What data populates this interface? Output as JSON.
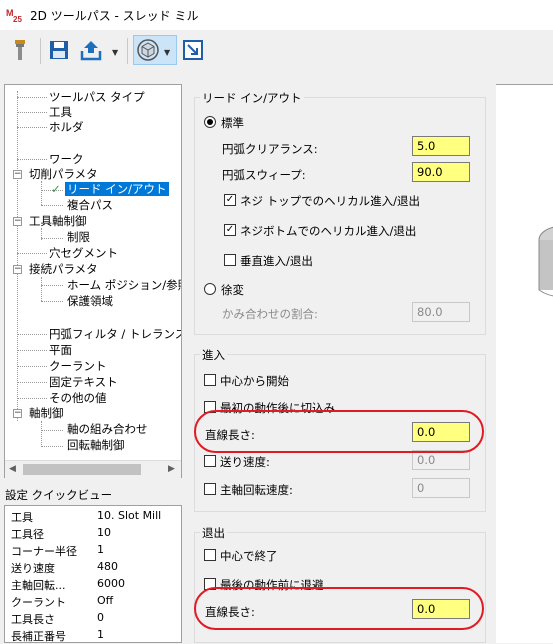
{
  "window": {
    "title": "2D ツールパス - スレッド ミル"
  },
  "toolbar": {
    "icons": [
      "tool-icon",
      "save-icon",
      "upload-icon",
      "view-cube-icon",
      "window-resize-icon"
    ]
  },
  "tree": {
    "items": [
      {
        "label": "ツールパス タイプ"
      },
      {
        "label": "工具"
      },
      {
        "label": "ホルダ"
      },
      {
        "label": "ワーク"
      },
      {
        "label": "切削パラメタ"
      },
      {
        "label": "リード イン/アウト",
        "selected": true
      },
      {
        "label": "複合パス"
      },
      {
        "label": "工具軸制御"
      },
      {
        "label": "制限"
      },
      {
        "label": "穴セグメント"
      },
      {
        "label": "接続パラメタ"
      },
      {
        "label": "ホーム ポジション/参照点"
      },
      {
        "label": "保護領域"
      },
      {
        "label": "円弧フィルタ / トレランス"
      },
      {
        "label": "平面"
      },
      {
        "label": "クーラント"
      },
      {
        "label": "固定テキスト"
      },
      {
        "label": "その他の値"
      },
      {
        "label": "軸制御"
      },
      {
        "label": "軸の組み合わせ"
      },
      {
        "label": "回転軸制御"
      }
    ]
  },
  "quickview": {
    "title": "設定 クイックビュー",
    "rows": [
      {
        "key": "工具",
        "value": "10. Slot Mill"
      },
      {
        "key": "工具径",
        "value": "10"
      },
      {
        "key": "コーナー半径",
        "value": "1"
      },
      {
        "key": "送り速度",
        "value": "480"
      },
      {
        "key": "主軸回転...",
        "value": "6000"
      },
      {
        "key": "クーラント",
        "value": "Off"
      },
      {
        "key": "工具長さ",
        "value": "0"
      },
      {
        "key": "長補正番号",
        "value": "1"
      }
    ]
  },
  "leadinout": {
    "group_title": "リード イン/アウト",
    "standard_label": "標準",
    "arc_clearance_label": "円弧クリアランス:",
    "arc_clearance_value": "5.0",
    "arc_sweep_label": "円弧スウィープ:",
    "arc_sweep_value": "90.0",
    "helical_top_label": "ネジ トップでのヘリカル進入/退出",
    "helical_bottom_label": "ネジボトムでのヘリカル進入/退出",
    "vertical_label": "垂直進入/退出",
    "gradual_label": "徐変",
    "overlap_label": "かみ合わせの割合:",
    "overlap_value": "80.0"
  },
  "entry": {
    "group_title": "進入",
    "start_center_label": "中心から開始",
    "plunge_first_label": "最初の動作後に切込み",
    "line_length_label": "直線長さ:",
    "line_length_value": "0.0",
    "feed_label": "送り速度:",
    "feed_value": "0.0",
    "spindle_label": "主軸回転速度:",
    "spindle_value": "0"
  },
  "exit": {
    "group_title": "退出",
    "end_center_label": "中心で終了",
    "retract_last_label": "最後の動作前に退避",
    "line_length_label": "直線長さ:",
    "line_length_value": "0.0"
  },
  "colors": {
    "accent": "#0078d7",
    "field": "#ffff80",
    "highlight": "#e01b24"
  }
}
